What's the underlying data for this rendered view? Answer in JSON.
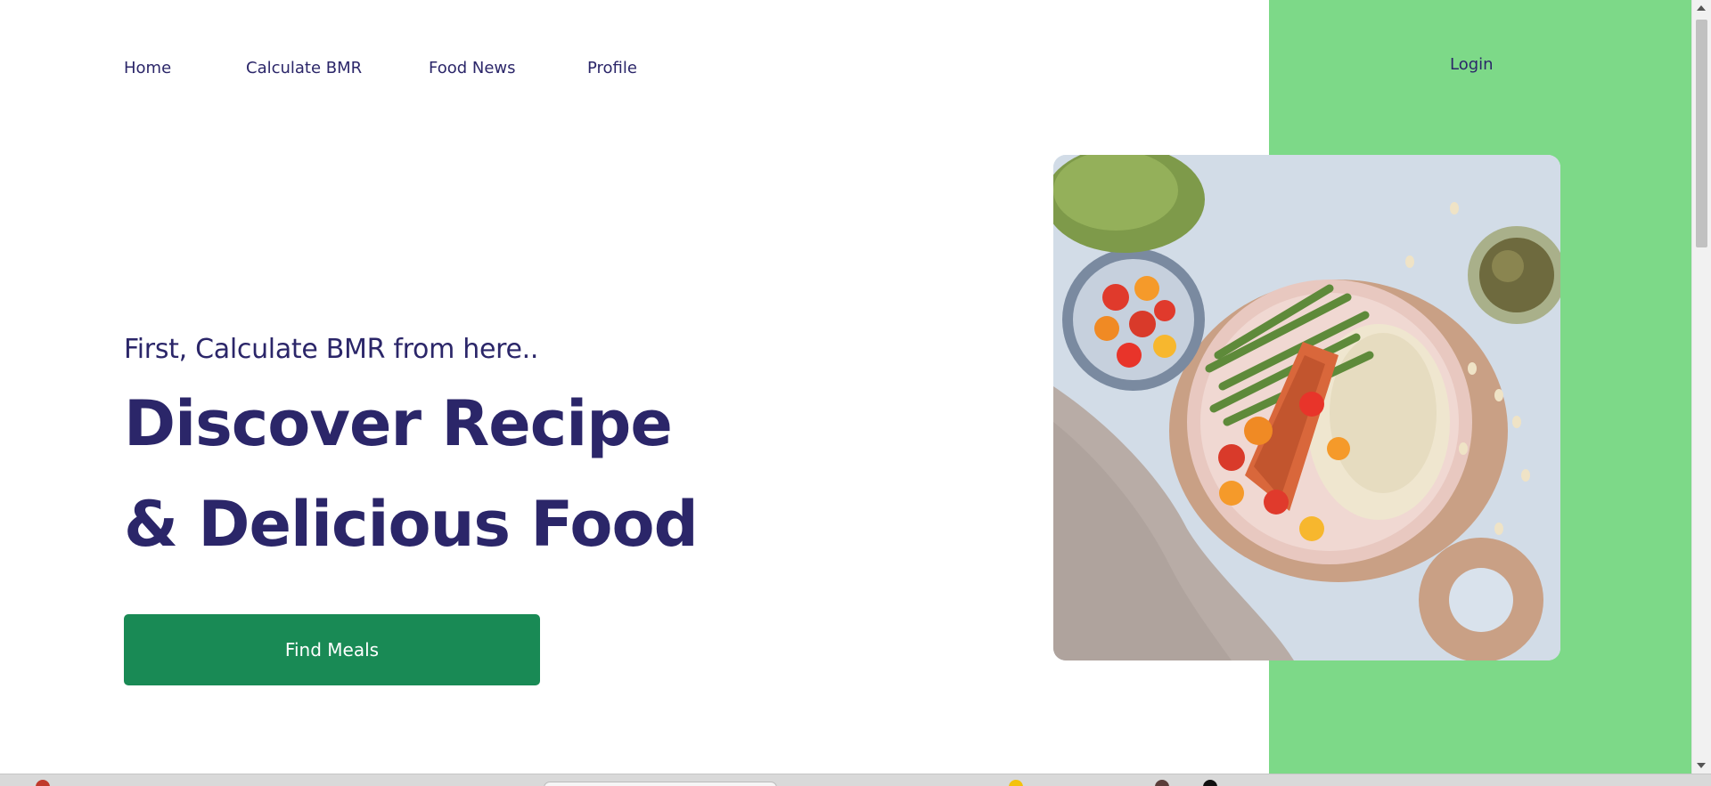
{
  "nav": {
    "items": [
      {
        "label": "Home"
      },
      {
        "label": "Calculate BMR"
      },
      {
        "label": "Food News"
      },
      {
        "label": "Profile"
      }
    ],
    "login_label": "Login"
  },
  "hero": {
    "subtitle": "First, Calculate BMR from here..",
    "headline_line1": "Discover Recipe",
    "headline_line2": "& Delicious Food",
    "cta_label": "Find Meals"
  },
  "colors": {
    "accent_green_panel": "#7dd988",
    "button_green": "#198a55",
    "text_navy": "#2b2669"
  },
  "image": {
    "icon": "food-plate-image"
  }
}
